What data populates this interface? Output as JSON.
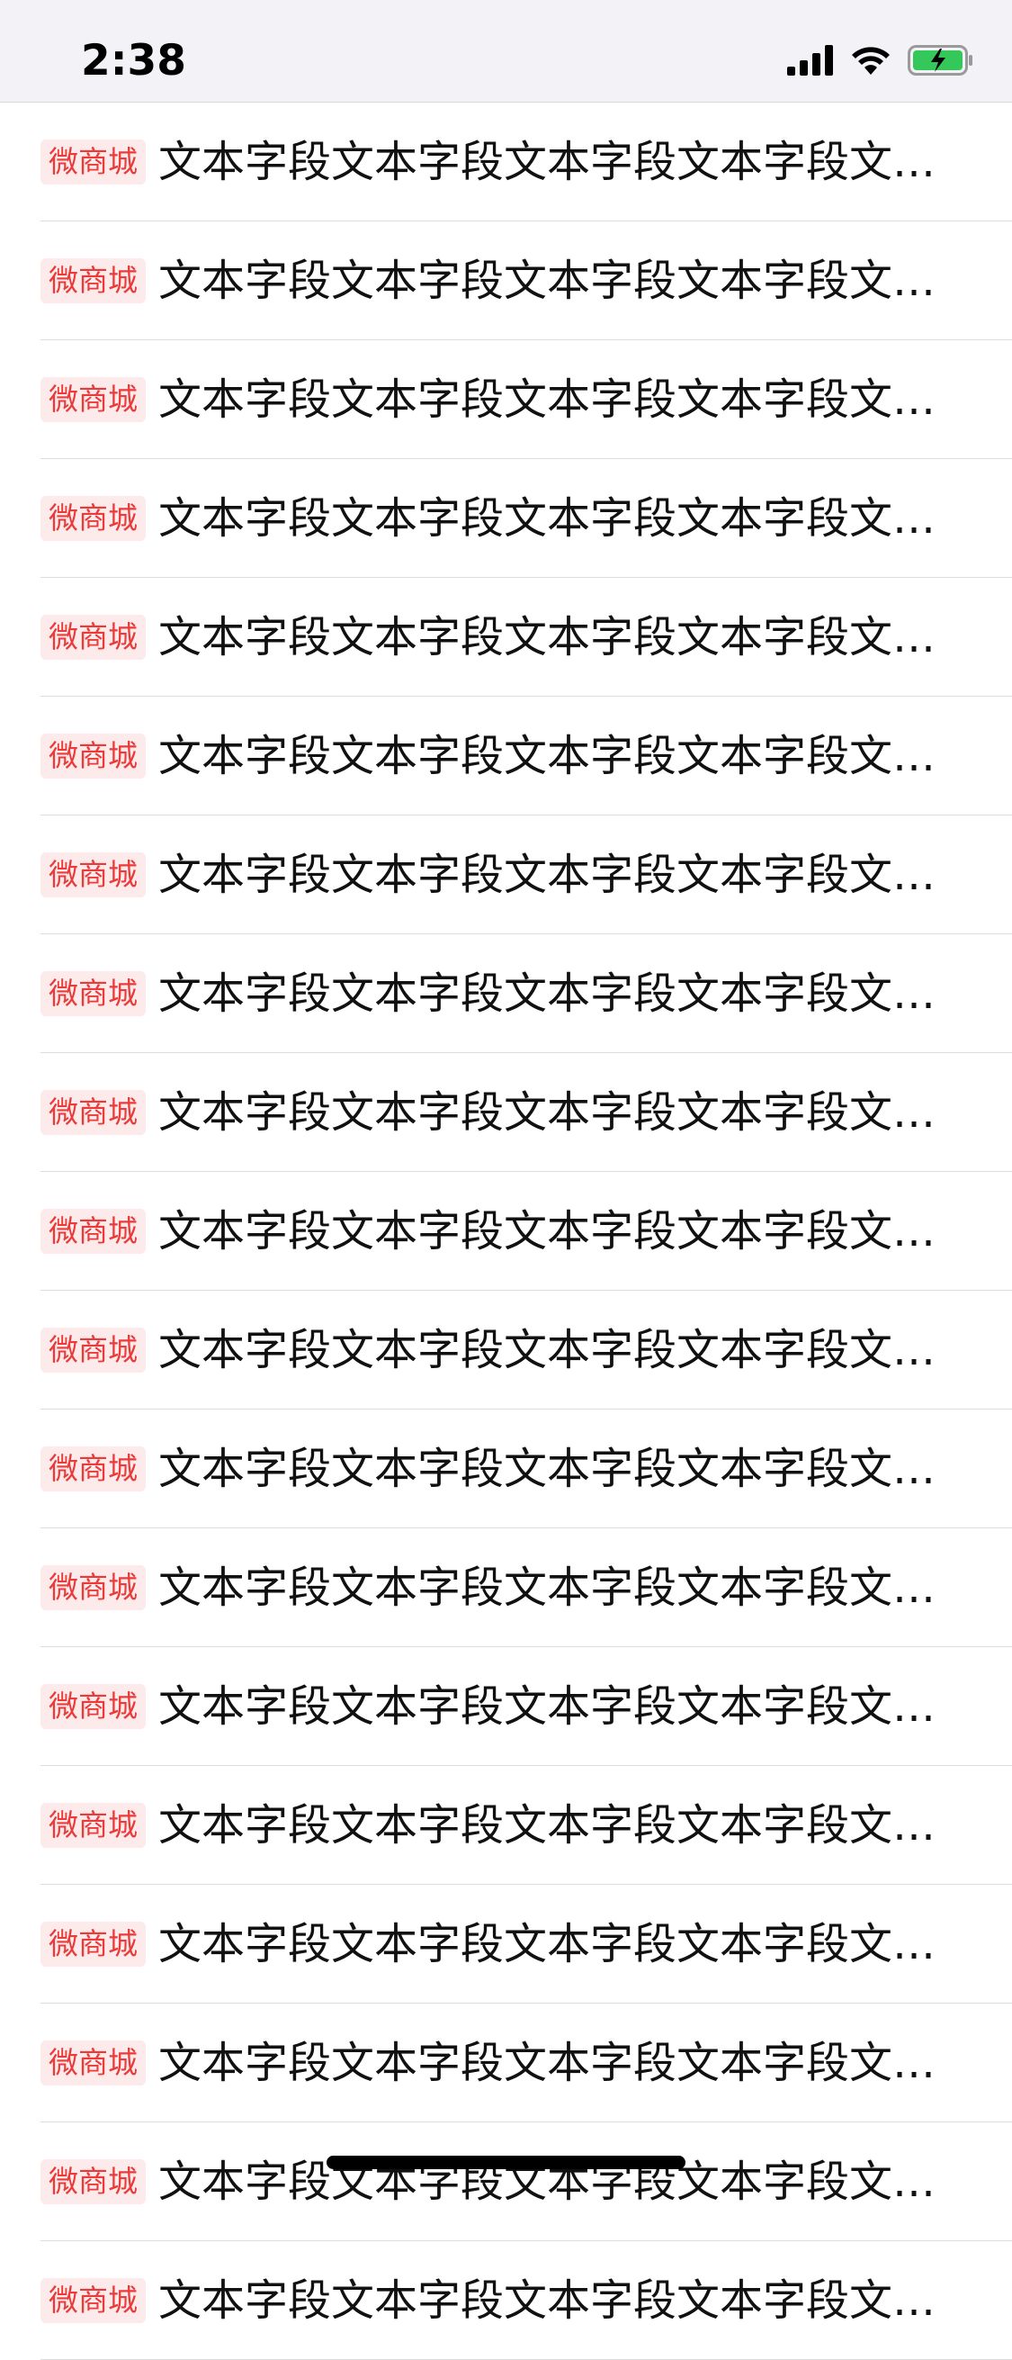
{
  "status_bar": {
    "time": "2:38",
    "icons": [
      "cellular-signal-icon",
      "wifi-icon",
      "battery-charging-icon"
    ],
    "battery_color": "#34c759"
  },
  "colors": {
    "tag_text": "#ea3a3a",
    "tag_background": "#fdeaea",
    "separator": "#dcdcdc"
  },
  "list": {
    "items": [
      {
        "tag": "微商城",
        "text": "文本字段文本字段文本字段文本字段文本字段文本字段"
      },
      {
        "tag": "微商城",
        "text": "文本字段文本字段文本字段文本字段文本字段文本字段"
      },
      {
        "tag": "微商城",
        "text": "文本字段文本字段文本字段文本字段文本字段文本字段"
      },
      {
        "tag": "微商城",
        "text": "文本字段文本字段文本字段文本字段文本字段文本字段"
      },
      {
        "tag": "微商城",
        "text": "文本字段文本字段文本字段文本字段文本字段文本字段"
      },
      {
        "tag": "微商城",
        "text": "文本字段文本字段文本字段文本字段文本字段文本字段"
      },
      {
        "tag": "微商城",
        "text": "文本字段文本字段文本字段文本字段文本字段文本字段"
      },
      {
        "tag": "微商城",
        "text": "文本字段文本字段文本字段文本字段文本字段文本字段"
      },
      {
        "tag": "微商城",
        "text": "文本字段文本字段文本字段文本字段文本字段文本字段"
      },
      {
        "tag": "微商城",
        "text": "文本字段文本字段文本字段文本字段文本字段文本字段"
      },
      {
        "tag": "微商城",
        "text": "文本字段文本字段文本字段文本字段文本字段文本字段"
      },
      {
        "tag": "微商城",
        "text": "文本字段文本字段文本字段文本字段文本字段文本字段"
      },
      {
        "tag": "微商城",
        "text": "文本字段文本字段文本字段文本字段文本字段文本字段"
      },
      {
        "tag": "微商城",
        "text": "文本字段文本字段文本字段文本字段文本字段文本字段"
      },
      {
        "tag": "微商城",
        "text": "文本字段文本字段文本字段文本字段文本字段文本字段"
      },
      {
        "tag": "微商城",
        "text": "文本字段文本字段文本字段文本字段文本字段文本字段"
      },
      {
        "tag": "微商城",
        "text": "文本字段文本字段文本字段文本字段文本字段文本字段"
      },
      {
        "tag": "微商城",
        "text": "文本字段文本字段文本字段文本字段文本字段文本字段"
      },
      {
        "tag": "微商城",
        "text": "文本字段文本字段文本字段文本字段文本字段文本字段"
      }
    ]
  }
}
